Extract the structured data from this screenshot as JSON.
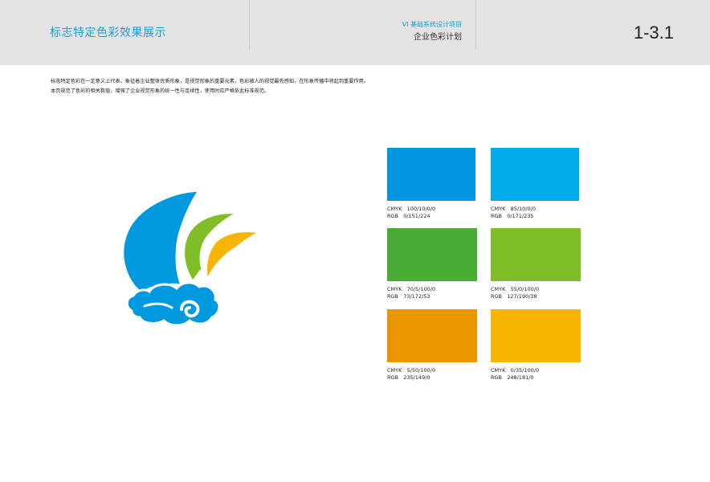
{
  "header": {
    "section_title": "标志特定色彩效果展示",
    "project_label": "VI 基础系统设计项目",
    "plan_label": "企业色彩计划",
    "page_number": "1-3.1"
  },
  "description": {
    "line1": "标志特定色彩在一定意义上代表、象征着企业整体优质形象，是视觉形象的重要元素。色彩被人的视觉最先感知，在形象传播中将起到重要作用。",
    "line2": "本页规范了色彩的相关数值，增强了企业视觉形象的统一性与连续性，使用时应严格依此标准规范。"
  },
  "logo": {
    "icon": "sail-cloud-logo-icon",
    "colors": {
      "blue": "#0099e0",
      "green": "#7fbe26",
      "orange": "#f8b500"
    }
  },
  "swatches": [
    {
      "color": "#0097e0",
      "cmyk_label": "CMYK   100/10/0/0",
      "rgb_label": "RGB   0/151/224"
    },
    {
      "color": "#00abeb",
      "cmyk_label": "CMYK   85/10/0/0",
      "rgb_label": "RGB   0/171/235"
    },
    {
      "color": "#49ac35",
      "cmyk_label": "CMYK   70/5/100/0",
      "rgb_label": "RGB   73/172/53"
    },
    {
      "color": "#7fbe26",
      "cmyk_label": "CMYK   55/0/100/0",
      "rgb_label": "RGB   127/190/38"
    },
    {
      "color": "#eb9500",
      "cmyk_label": "CMYK   5/50/100/0",
      "rgb_label": "RGB   235/149/0"
    },
    {
      "color": "#f8b500",
      "cmyk_label": "CMYK   0/35/100/0",
      "rgb_label": "RGB   248/181/0"
    }
  ]
}
